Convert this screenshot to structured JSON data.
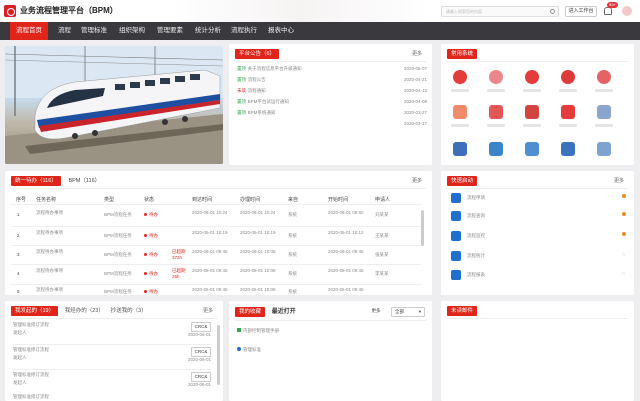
{
  "app": {
    "title": "业务流程管理平台（BPM）",
    "search_placeholder": "请输入搜索您的内容",
    "enter_workspace": "进入工作台",
    "notify_count": "99+"
  },
  "nav": [
    "流程首页",
    "流程",
    "管理标准",
    "组织架构",
    "管理要素",
    "统计分析",
    "流程执行",
    "报表中心"
  ],
  "notice": {
    "title": "平台公告（6）",
    "more": "更多",
    "items": [
      {
        "tag": "置顶",
        "text": "关于流程信息平台升级通知",
        "date": "2020-05-07"
      },
      {
        "tag": "置顶",
        "text": "流程公告",
        "date": "2020-04-21"
      },
      {
        "tag": "未读",
        "text": "流程通知",
        "date": "2020-04-13"
      },
      {
        "tag": "置顶",
        "text": "BPM平台试运行通知",
        "date": "2020-04-08"
      },
      {
        "tag": "置顶",
        "text": "BPM系统通知",
        "date": "2020-03-27"
      },
      {
        "tag": "",
        "text": "",
        "date": "2020-03-17"
      }
    ]
  },
  "common_systems": {
    "title": "常用系统"
  },
  "todo": {
    "tab1": "统一待办（116）",
    "tab2": "BPM（116）",
    "more": "更多",
    "headers": [
      "序号",
      "任务名称",
      "类型",
      "状态",
      "到达时间",
      "办理时间",
      "来自",
      "开始时间",
      "申请人"
    ],
    "rows": [
      {
        "no": "1",
        "name": "流程待办事项",
        "type": "BPM流程任务",
        "status": "待办",
        "arrive": "2020-06-01 10:24",
        "handle": "2020-06-01 10:24",
        "from": "系统",
        "start": "2020-06-01 09:50",
        "applicant": "刘某某"
      },
      {
        "no": "2",
        "name": "流程待办事项",
        "type": "BPM流程任务",
        "status": "待办",
        "arrive": "2020-06-01 10:19",
        "handle": "2020-06-01 10:19",
        "from": "系统",
        "start": "2020-06-01 10:12",
        "applicant": "王某某"
      },
      {
        "no": "3",
        "name": "流程待办事项",
        "type": "BPM流程任务",
        "status": "待办",
        "overdue": "已超期372h",
        "arrive": "2020-06-01 09:45",
        "handle": "2020-06-01 10:08",
        "from": "系统",
        "start": "2020-06-01 09:45",
        "applicant": "张某某"
      },
      {
        "no": "4",
        "name": "流程待办事项",
        "type": "BPM流程任务",
        "status": "待办",
        "overdue": "已超期25h",
        "arrive": "2020-06-01 09:45",
        "handle": "2020-06-01 10:08",
        "from": "系统",
        "start": "2020-06-01 09:45",
        "applicant": "李某某"
      },
      {
        "no": "5",
        "name": "流程待办事项",
        "type": "BPM流程任务",
        "status": "待办",
        "arrive": "2020-06-01 09:45",
        "handle": "2020-06-01 10:08",
        "from": "系统",
        "start": "2020-06-01 09:45",
        "applicant": ""
      }
    ]
  },
  "quick": {
    "title": "快速启动",
    "more": "更多",
    "items": [
      "流程申请",
      "流程查询",
      "流程监控",
      "流程统计",
      "流程报表"
    ]
  },
  "my": {
    "tab1": "我发起的（19）",
    "tab2": "我经办的（23）",
    "tab3": "抄送我的（3）",
    "more": "更多",
    "items": [
      {
        "title": "管理标准修订流程",
        "action": "CRC&",
        "who": "发起人",
        "date": "2020-06-01"
      },
      {
        "title": "管理标准修订流程",
        "action": "CRC&",
        "who": "发起人",
        "date": "2020-06-01"
      },
      {
        "title": "管理标准修订流程",
        "action": "CRC&",
        "who": "发起人",
        "date": "2020-06-01"
      },
      {
        "title": "管理标准修订流程",
        "action": "CRC&",
        "who": "发起人",
        "date": "2020-06-01"
      }
    ]
  },
  "fav": {
    "tab1": "我的收藏",
    "tab2": "最近打开",
    "more": "更多",
    "filter": "全部",
    "items": [
      "内部控制管理手册",
      "管理标准"
    ]
  },
  "unread": {
    "title": "未读邮件"
  }
}
